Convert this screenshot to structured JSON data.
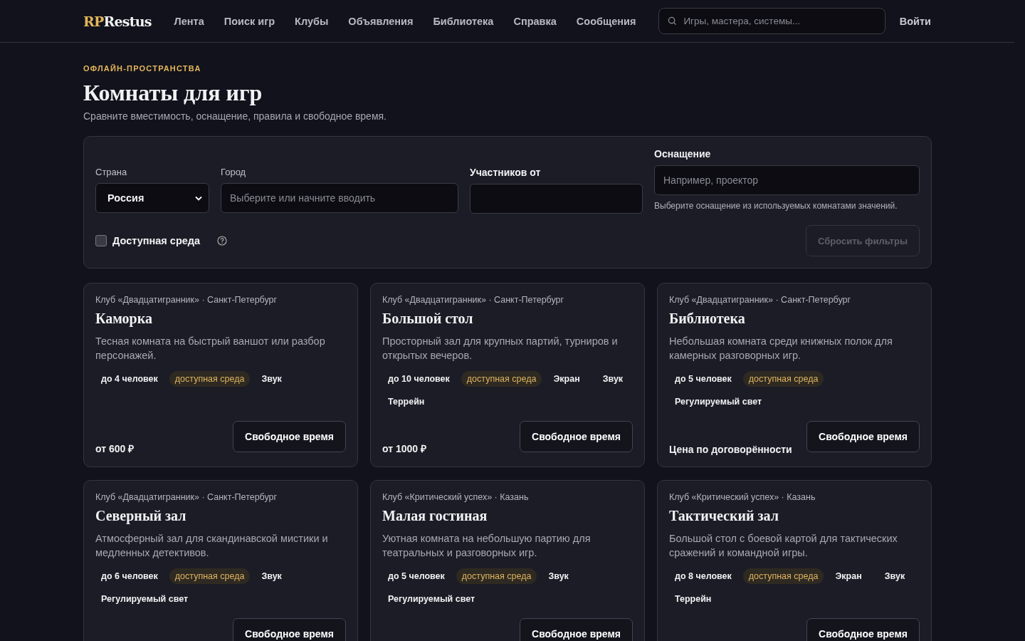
{
  "header": {
    "logo": {
      "accent": "RP",
      "rest": "Restus"
    },
    "nav": [
      "Лента",
      "Поиск игр",
      "Клубы",
      "Объявления",
      "Библиотека",
      "Справка",
      "Сообщения"
    ],
    "search": {
      "placeholder": "Игры, мастера, системы..."
    },
    "login": "Войти"
  },
  "page": {
    "eyebrow": "ОФЛАЙН-ПРОСТРАНСТВА",
    "title": "Комнаты для игр",
    "subtitle": "Сравните вместимость, оснащение, правила и свободное время."
  },
  "filters": {
    "country": {
      "label": "Страна",
      "value": "Россия"
    },
    "city": {
      "label": "Город",
      "placeholder": "Выберите или начните вводить"
    },
    "participants": {
      "label": "Участников от"
    },
    "equipment": {
      "label": "Оснащение",
      "placeholder": "Например, проектор",
      "hint": "Выберите оснащение из используемых комнатами значений."
    },
    "accessible": {
      "label": "Доступная среда",
      "checked": false
    },
    "reset": {
      "label": "Сбросить фильтры",
      "disabled": true
    }
  },
  "rooms": [
    {
      "club": "Клуб «Двадцатигранник» · Санкт-Петербург",
      "name": "Каморка",
      "description": "Тесная комната на быстрый ваншот или разбор персонажей.",
      "tags": [
        {
          "text": "до 4 человек",
          "kind": "plain"
        },
        {
          "text": "доступная среда",
          "kind": "accessible"
        },
        {
          "text": "Звук",
          "kind": "plain"
        }
      ],
      "price": "от 600 ₽",
      "button": "Свободное время"
    },
    {
      "club": "Клуб «Двадцатигранник» · Санкт-Петербург",
      "name": "Большой стол",
      "description": "Просторный зал для крупных партий, турниров и открытых вечеров.",
      "tags": [
        {
          "text": "до 10 человек",
          "kind": "plain"
        },
        {
          "text": "доступная среда",
          "kind": "accessible"
        },
        {
          "text": "Экран",
          "kind": "plain"
        },
        {
          "text": "Звук",
          "kind": "plain"
        },
        {
          "text": "Террейн",
          "kind": "plain"
        }
      ],
      "price": "от 1000 ₽",
      "button": "Свободное время"
    },
    {
      "club": "Клуб «Двадцатигранник» · Санкт-Петербург",
      "name": "Библиотека",
      "description": "Небольшая комната среди книжных полок для камерных разговорных игр.",
      "tags": [
        {
          "text": "до 5 человек",
          "kind": "plain"
        },
        {
          "text": "доступная среда",
          "kind": "accessible"
        },
        {
          "text": "Регулируемый свет",
          "kind": "plain"
        }
      ],
      "price": "Цена по договорённости",
      "button": "Свободное время"
    },
    {
      "club": "Клуб «Двадцатигранник» · Санкт-Петербург",
      "name": "Северный зал",
      "description": "Атмосферный зал для скандинавской мистики и медленных детективов.",
      "tags": [
        {
          "text": "до 6 человек",
          "kind": "plain"
        },
        {
          "text": "доступная среда",
          "kind": "accessible"
        },
        {
          "text": "Звук",
          "kind": "plain"
        },
        {
          "text": "Регулируемый свет",
          "kind": "plain"
        }
      ],
      "button": "Свободное время"
    },
    {
      "club": "Клуб «Критический успех» · Казань",
      "name": "Малая гостиная",
      "description": "Уютная комната на небольшую партию для театральных и разговорных игр.",
      "tags": [
        {
          "text": "до 5 человек",
          "kind": "plain"
        },
        {
          "text": "доступная среда",
          "kind": "accessible"
        },
        {
          "text": "Звук",
          "kind": "plain"
        },
        {
          "text": "Регулируемый свет",
          "kind": "plain"
        }
      ],
      "button": "Свободное время"
    },
    {
      "club": "Клуб «Критический успех» · Казань",
      "name": "Тактический зал",
      "description": "Большой стол с боевой картой для тактических сражений и командной игры.",
      "tags": [
        {
          "text": "до 8 человек",
          "kind": "plain"
        },
        {
          "text": "доступная среда",
          "kind": "accessible"
        },
        {
          "text": "Экран",
          "kind": "plain"
        },
        {
          "text": "Звук",
          "kind": "plain"
        },
        {
          "text": "Террейн",
          "kind": "plain"
        }
      ],
      "button": "Свободное время"
    }
  ]
}
